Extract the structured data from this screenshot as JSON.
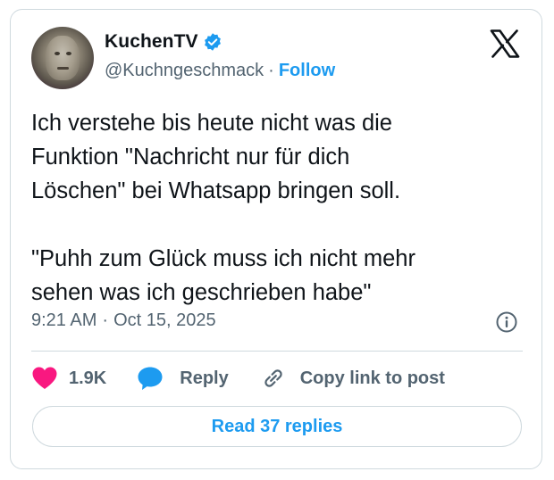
{
  "author": {
    "display_name": "KuchenTV",
    "handle": "@Kuchngeschmack",
    "separator": "·",
    "follow_label": "Follow",
    "verified": true
  },
  "icons": {
    "platform": "x-logo-icon",
    "verified": "verified-badge-icon",
    "info": "info-icon",
    "like": "heart-icon",
    "reply": "speech-bubble-icon",
    "copy": "link-icon"
  },
  "tweet": {
    "text": "Ich verstehe bis heute nicht was die\nFunktion \"Nachricht nur für dich\nLöschen\" bei Whatsapp bringen soll.\n\n\"Puhh zum Glück muss ich nicht mehr\nsehen was ich geschrieben habe\"",
    "time": "9:21 AM",
    "separator": "·",
    "date": "Oct 15, 2025"
  },
  "actions": {
    "likes": "1.9K",
    "reply_label": "Reply",
    "copy_label": "Copy link to post"
  },
  "read_replies_label": "Read 37 replies",
  "colors": {
    "accent": "#1d9bf0",
    "like": "#f91880",
    "text": "#0f1419",
    "muted": "#536471",
    "border": "#cfd9de"
  }
}
